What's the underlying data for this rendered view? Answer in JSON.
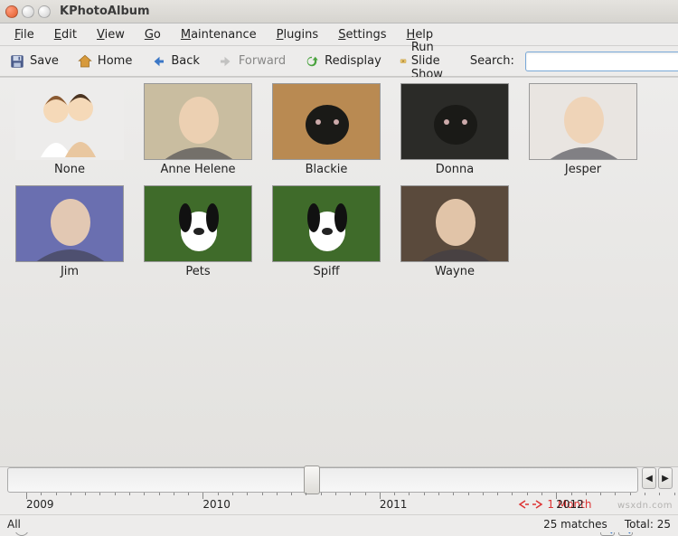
{
  "window": {
    "title": "KPhotoAlbum"
  },
  "menu": {
    "file": "File",
    "edit": "Edit",
    "view": "View",
    "go": "Go",
    "maintenance": "Maintenance",
    "plugins": "Plugins",
    "settings": "Settings",
    "help": "Help"
  },
  "toolbar": {
    "save": "Save",
    "home": "Home",
    "back": "Back",
    "forward": "Forward",
    "redisplay": "Redisplay",
    "slideshow": "Run Slide Show",
    "search_label": "Search:",
    "search_value": ""
  },
  "thumbs": [
    {
      "label": "None",
      "kind": "placeholder"
    },
    {
      "label": "Anne Helene",
      "kind": "photo",
      "bg": "#c9bda0"
    },
    {
      "label": "Blackie",
      "kind": "photo",
      "bg": "#b98a52"
    },
    {
      "label": "Donna",
      "kind": "photo",
      "bg": "#2b2b28"
    },
    {
      "label": "Jesper",
      "kind": "photo",
      "bg": "#e9e5e1"
    },
    {
      "label": "Jim",
      "kind": "photo",
      "bg": "#6a6fb0"
    },
    {
      "label": "Pets",
      "kind": "photo",
      "bg": "#3f6b2a"
    },
    {
      "label": "Spiff",
      "kind": "photo",
      "bg": "#3f6b2a"
    },
    {
      "label": "Wayne",
      "kind": "photo",
      "bg": "#5a4a3c"
    }
  ],
  "timeline": {
    "years": [
      "2009",
      "2010",
      "2011",
      "2012"
    ],
    "range_label": "1 Month",
    "handle_pct": 47
  },
  "status": {
    "left": "All",
    "matches": "25 matches",
    "total": "Total: 25"
  },
  "watermark": "wsxdn.com"
}
